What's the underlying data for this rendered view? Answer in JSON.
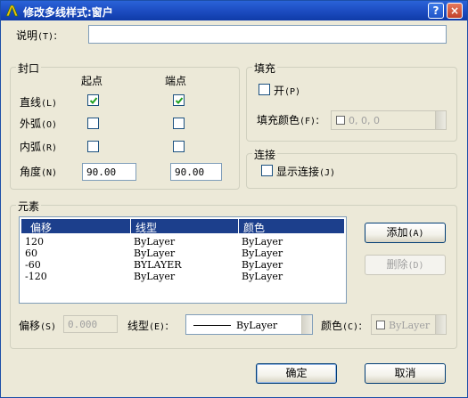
{
  "window": {
    "title": "修改多线样式:窗户",
    "help": "?",
    "close": "×"
  },
  "description": {
    "label": "说明",
    "shortcut": "(T)",
    "value": ""
  },
  "caps": {
    "group_title": "封口",
    "col_start": "起点",
    "col_end": "端点",
    "rows": [
      {
        "label": "直线",
        "shortcut": "(L)",
        "start": true,
        "end": true
      },
      {
        "label": "外弧",
        "shortcut": "(O)",
        "start": false,
        "end": false
      },
      {
        "label": "内弧",
        "shortcut": "(R)",
        "start": false,
        "end": false
      }
    ],
    "angle": {
      "label": "角度",
      "shortcut": "(N)",
      "start_value": "90.00",
      "end_value": "90.00"
    }
  },
  "fill": {
    "group_title": "填充",
    "on_label": "开",
    "on_shortcut": "(P)",
    "on_checked": false,
    "color_label": "填充颜色",
    "color_shortcut": "(F)",
    "color_value": "0, 0, 0"
  },
  "joints": {
    "group_title": "连接",
    "show_label": "显示连接",
    "show_shortcut": "(J)",
    "show_checked": false
  },
  "elements": {
    "group_title": "元素",
    "columns": [
      "偏移",
      "线型",
      "颜色"
    ],
    "rows": [
      {
        "offset": "120",
        "linetype": "ByLayer",
        "color": "ByLayer"
      },
      {
        "offset": "60",
        "linetype": "ByLayer",
        "color": "ByLayer"
      },
      {
        "offset": "-60",
        "linetype": "BYLAYER",
        "color": "ByLayer"
      },
      {
        "offset": "-120",
        "linetype": "ByLayer",
        "color": "ByLayer"
      }
    ],
    "add_button": "添加",
    "add_shortcut": "(A)",
    "delete_button": "删除",
    "delete_shortcut": "(D)",
    "offset_label": "偏移",
    "offset_shortcut": "(S)",
    "offset_value": "0.000",
    "linetype_label": "线型",
    "linetype_shortcut": "(E)",
    "linetype_value": "ByLayer",
    "color_label": "颜色",
    "color_shortcut": "(C)",
    "color_value": "ByLayer"
  },
  "footer": {
    "ok": "确定",
    "cancel": "取消"
  }
}
